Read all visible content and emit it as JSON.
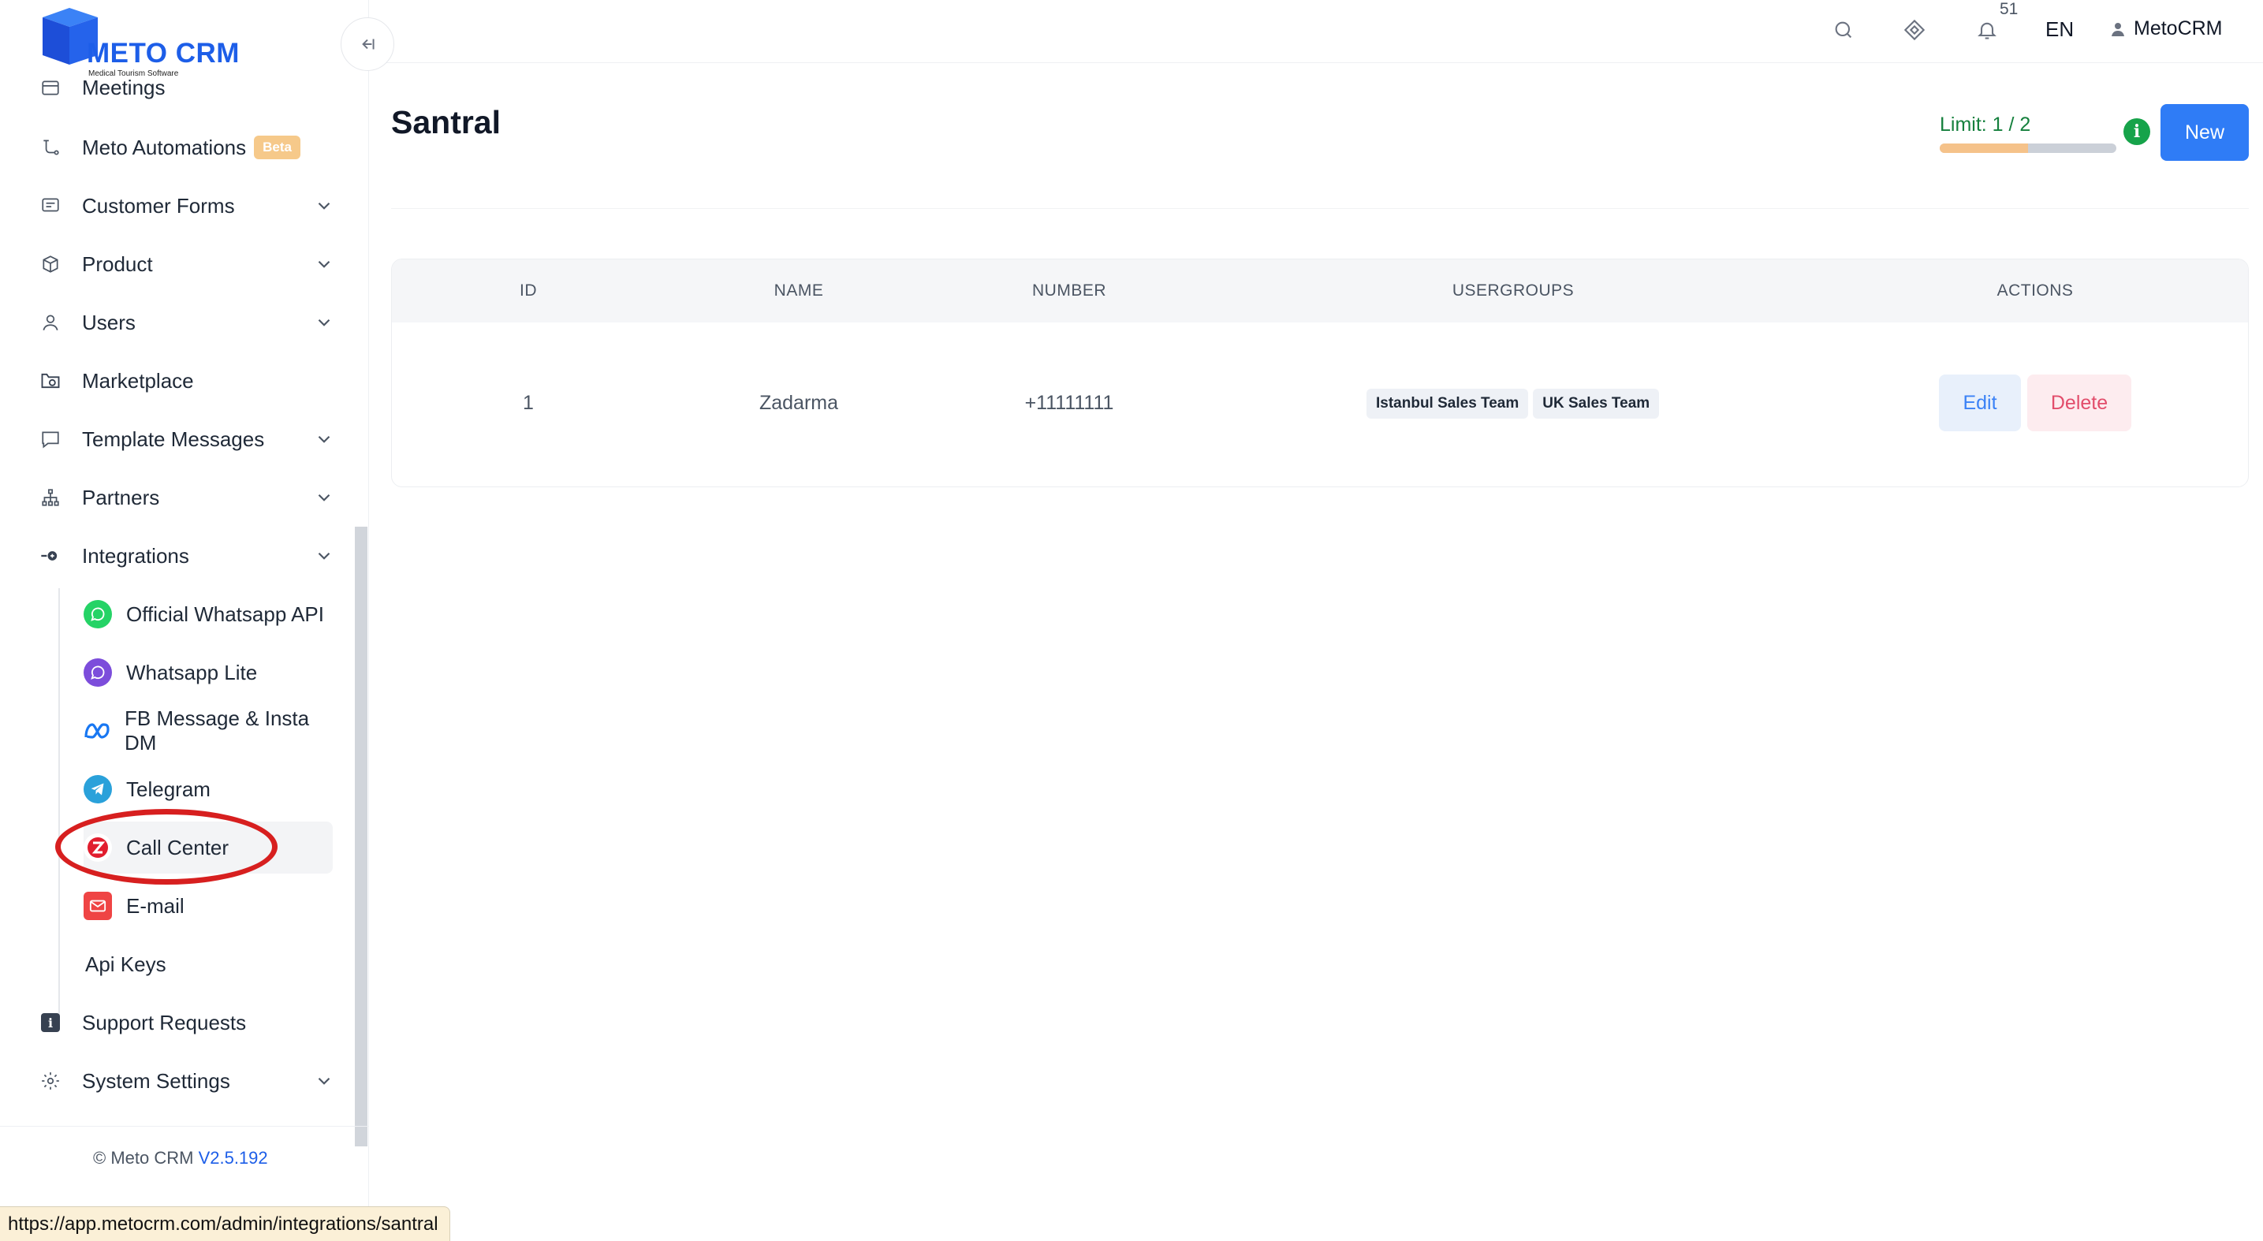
{
  "app": {
    "brand": "METO CRM",
    "tagline": "Medical Tourism Software"
  },
  "sidebar": {
    "items": [
      {
        "label": "Meetings",
        "icon": "calendar-icon"
      },
      {
        "label": "Meto Automations",
        "icon": "automation-icon",
        "badge": "Beta"
      },
      {
        "label": "Customer Forms",
        "icon": "form-icon",
        "has_submenu": true
      },
      {
        "label": "Product",
        "icon": "box-icon",
        "has_submenu": true
      },
      {
        "label": "Users",
        "icon": "user-icon",
        "has_submenu": true
      },
      {
        "label": "Marketplace",
        "icon": "marketplace-icon"
      },
      {
        "label": "Template Messages",
        "icon": "message-icon",
        "has_submenu": true
      },
      {
        "label": "Partners",
        "icon": "partners-icon",
        "has_submenu": true
      },
      {
        "label": "Integrations",
        "icon": "integrations-icon",
        "has_submenu": true,
        "expanded": true
      }
    ],
    "integrations_sub": [
      {
        "label": "Official Whatsapp API",
        "icon": "whatsapp-icon"
      },
      {
        "label": "Whatsapp Lite",
        "icon": "whatsapp-lite-icon"
      },
      {
        "label": "FB Message & Insta DM",
        "icon": "meta-icon"
      },
      {
        "label": "Telegram",
        "icon": "telegram-icon"
      },
      {
        "label": "Call Center",
        "icon": "zadarma-icon",
        "active": true
      },
      {
        "label": "E-mail",
        "icon": "email-icon"
      }
    ],
    "api_keys": "Api Keys",
    "support": "Support Requests",
    "system_settings": "System Settings",
    "copyright_prefix": "© Meto CRM",
    "version": "V2.5.192"
  },
  "topbar": {
    "notification_count": "51",
    "language": "EN",
    "user_name": "MetoCRM"
  },
  "page": {
    "title": "Santral",
    "limit_label": "Limit: 1 / 2",
    "limit_used": 1,
    "limit_total": 2,
    "new_button": "New"
  },
  "table": {
    "columns": [
      "ID",
      "NAME",
      "NUMBER",
      "USERGROUPS",
      "ACTIONS"
    ],
    "rows": [
      {
        "id": "1",
        "name": "Zadarma",
        "number": "+11111111",
        "usergroups": [
          "Istanbul Sales Team",
          "UK Sales Team"
        ],
        "edit": "Edit",
        "delete": "Delete"
      }
    ]
  },
  "status_bar": {
    "url": "https://app.metocrm.com/admin/integrations/santral"
  },
  "colors": {
    "primary": "#2f7cf6",
    "brand": "#1d5ee8",
    "limit_text": "#15803d",
    "highlight": "#d71f1f"
  }
}
